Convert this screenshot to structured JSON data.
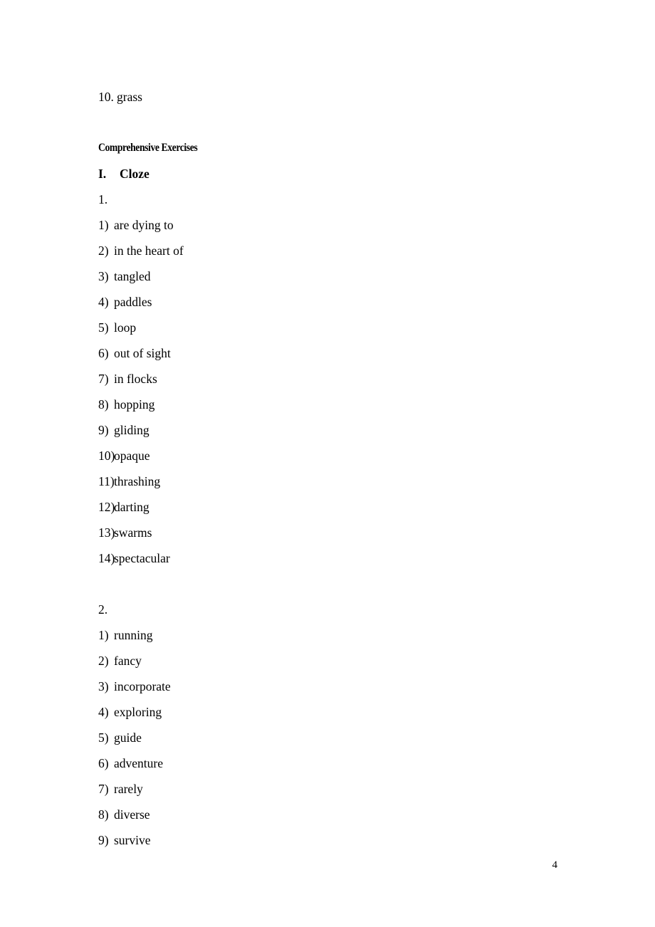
{
  "document": {
    "page_number": "4",
    "leading_item": {
      "number": "10.",
      "text": "grass"
    },
    "heading": "Comprehensive Exercises",
    "section": {
      "number": "I.",
      "title": "Cloze"
    },
    "groups": [
      {
        "label": "1.",
        "items": [
          {
            "num": "1)",
            "text": "are dying to"
          },
          {
            "num": "2)",
            "text": "in the heart of"
          },
          {
            "num": "3)",
            "text": "tangled"
          },
          {
            "num": "4)",
            "text": "paddles"
          },
          {
            "num": "5)",
            "text": "loop"
          },
          {
            "num": "6)",
            "text": "out of sight"
          },
          {
            "num": "7)",
            "text": "in flocks"
          },
          {
            "num": "8)",
            "text": "hopping"
          },
          {
            "num": "9)",
            "text": "gliding"
          },
          {
            "num": "10)",
            "text": "opaque"
          },
          {
            "num": "11)",
            "text": "thrashing"
          },
          {
            "num": "12)",
            "text": "darting"
          },
          {
            "num": "13)",
            "text": "swarms"
          },
          {
            "num": "14)",
            "text": "spectacular"
          }
        ]
      },
      {
        "label": "2.",
        "items": [
          {
            "num": "1)",
            "text": "running"
          },
          {
            "num": "2)",
            "text": "fancy"
          },
          {
            "num": "3)",
            "text": "incorporate"
          },
          {
            "num": "4)",
            "text": "exploring"
          },
          {
            "num": "5)",
            "text": "guide"
          },
          {
            "num": "6)",
            "text": "adventure"
          },
          {
            "num": "7)",
            "text": "rarely"
          },
          {
            "num": "8)",
            "text": "diverse"
          },
          {
            "num": "9)",
            "text": "survive"
          }
        ]
      }
    ]
  }
}
